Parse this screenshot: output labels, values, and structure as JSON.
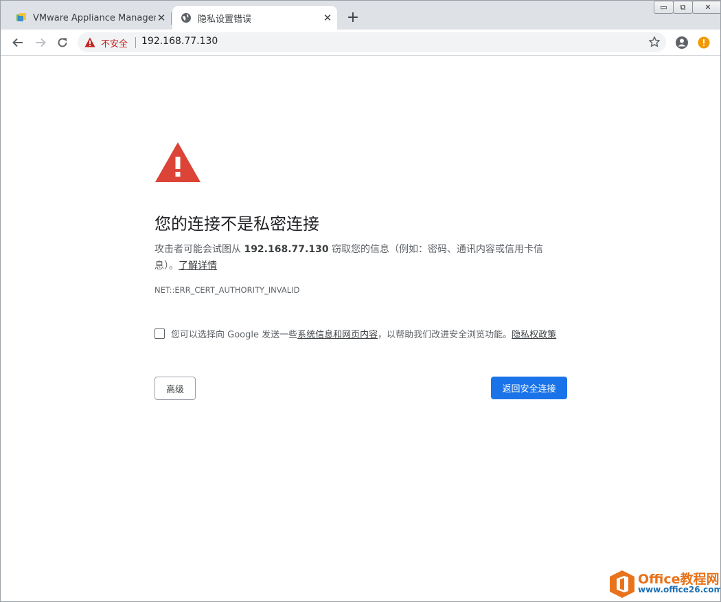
{
  "tabs": [
    {
      "title": "VMware Appliance Manageme",
      "close": "✕",
      "favicon": "vmware-icon"
    },
    {
      "title": "隐私设置错误",
      "close": "✕",
      "favicon": "globe-icon"
    }
  ],
  "new_tab_label": "+",
  "window_controls": {
    "minimize": "▭",
    "restore": "⧉",
    "close": "✕"
  },
  "omnibox": {
    "security_label": "不安全",
    "url": "192.168.77.130"
  },
  "interstitial": {
    "heading": "您的连接不是私密连接",
    "explain_prefix": "攻击者可能会试图从 ",
    "host": "192.168.77.130",
    "explain_suffix": " 窃取您的信息（例如：密码、通讯内容或信用卡信息）。",
    "learn_more": "了解详情",
    "error_code": "NET::ERR_CERT_AUTHORITY_INVALID",
    "optin_prefix": "您可以选择向 Google 发送一些",
    "optin_link": "系统信息和网页内容",
    "optin_middle": "，以帮助我们改进安全浏览功能。",
    "privacy_link": "隐私权政策",
    "advanced_button": "高级",
    "back_button": "返回安全连接"
  },
  "watermark": {
    "name": "Office教程网",
    "site": "www.office26.com"
  },
  "colors": {
    "warning_red": "#db4437",
    "insecure_text": "#c5221f",
    "primary_button": "#1a73e8",
    "tab_strip": "#dee1e6"
  }
}
